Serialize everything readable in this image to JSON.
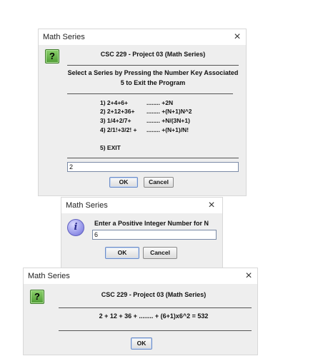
{
  "dialog1": {
    "title": "Math Series",
    "close_glyph": "×",
    "icon": "question-icon",
    "icon_glyph": "?",
    "header": "CSC 229 - Project 03 (Math Series)",
    "instruction_line1": "Select a Series by Pressing the Number Key Associated",
    "instruction_line2": "5 to Exit the Program",
    "menu": [
      {
        "expr": "1)  2+4+6+",
        "formula": "........ +2N"
      },
      {
        "expr": "2)  2+12+36+",
        "formula": "........ +(N+1)N^2"
      },
      {
        "expr": "3)  1/4+2/7+",
        "formula": "........ +N/(3N+1)"
      },
      {
        "expr": "4)  2/1!+3/2! +",
        "formula": "........ +(N+1)/N!"
      }
    ],
    "exit_option": "5)  EXIT",
    "input_value": "2",
    "ok_label": "OK",
    "cancel_label": "Cancel"
  },
  "dialog2": {
    "title": "Math Series",
    "close_glyph": "×",
    "icon": "info-icon",
    "icon_glyph": "i",
    "prompt": "Enter a Positive Integer Number for N",
    "input_value": "6",
    "ok_label": "OK",
    "cancel_label": "Cancel"
  },
  "dialog3": {
    "title": "Math Series",
    "close_glyph": "×",
    "icon": "question-icon",
    "icon_glyph": "?",
    "header": "CSC 229 - Project 03 (Math Series)",
    "result": "2 + 12 + 36 +  ........  + (6+1)x6^2 = 532",
    "ok_label": "OK"
  }
}
